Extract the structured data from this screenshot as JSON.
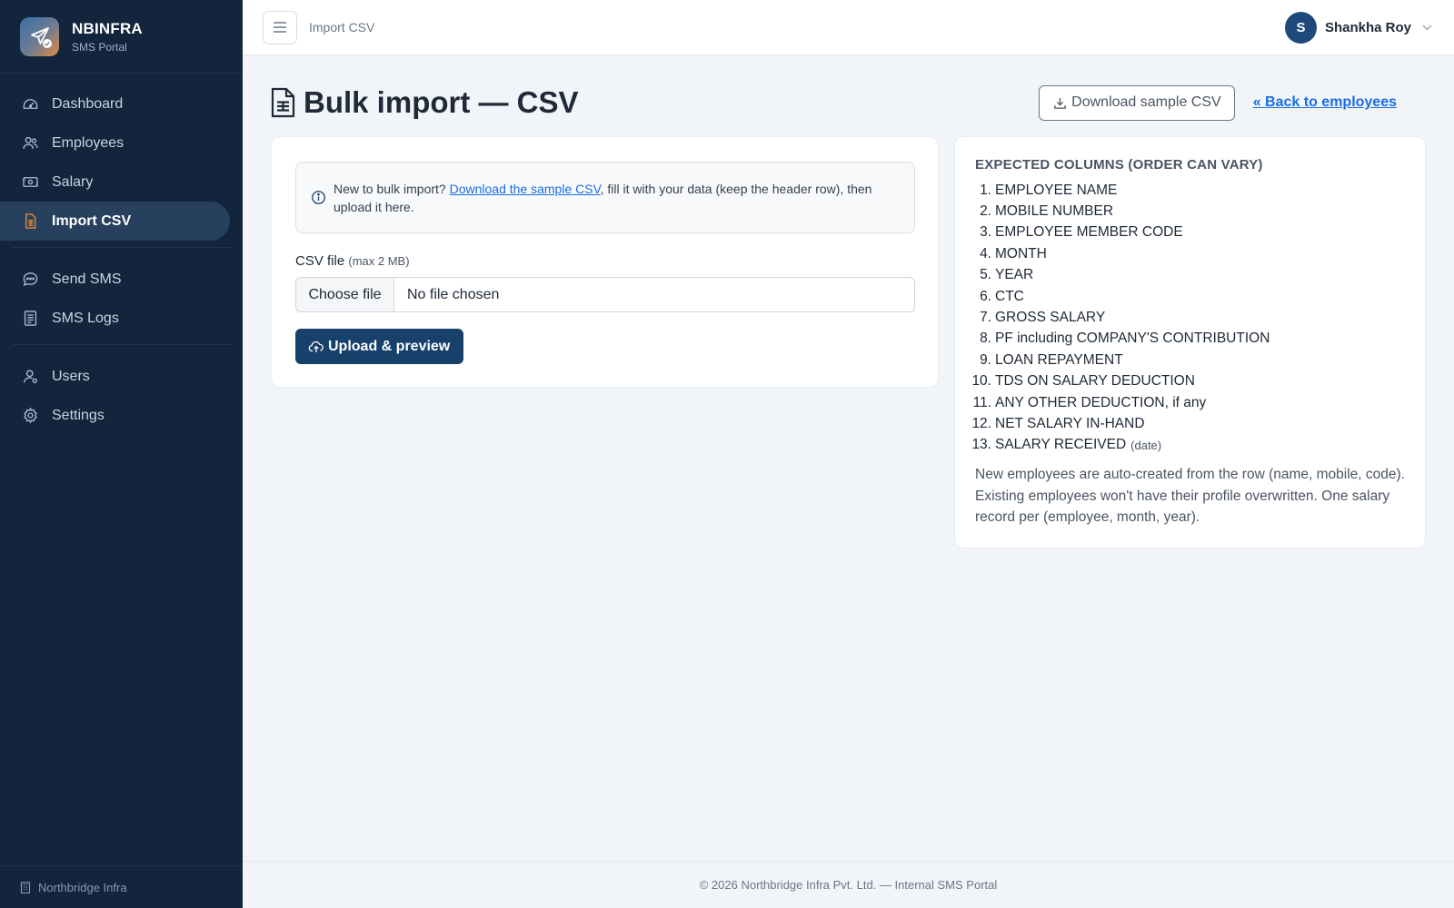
{
  "brand": {
    "name": "NBINFRA",
    "subtitle": "SMS Portal"
  },
  "sidebar": {
    "items": [
      {
        "label": "Dashboard",
        "icon": "gauge-icon",
        "active": false
      },
      {
        "label": "Employees",
        "icon": "users-icon",
        "active": false
      },
      {
        "label": "Salary",
        "icon": "cash-icon",
        "active": false
      },
      {
        "label": "Import CSV",
        "icon": "file-spreadsheet-icon",
        "active": true
      },
      {
        "label": "Send SMS",
        "icon": "chat-icon",
        "active": false
      },
      {
        "label": "SMS Logs",
        "icon": "log-icon",
        "active": false
      },
      {
        "label": "Users",
        "icon": "user-icon",
        "active": false
      },
      {
        "label": "Settings",
        "icon": "gear-icon",
        "active": false
      }
    ],
    "footer": "Northbridge Infra"
  },
  "topbar": {
    "title": "Import CSV",
    "user_initial": "S",
    "user_name": "Shankha Roy"
  },
  "page": {
    "title": "Bulk import — CSV",
    "download_button": "Download sample CSV",
    "back_link": "« Back to employees"
  },
  "upload": {
    "info_prefix": "New to bulk import? ",
    "info_link": "Download the sample CSV",
    "info_suffix": ", fill it with your data (keep the header row), then upload it here.",
    "field_label": "CSV file",
    "field_hint": "(max 2 MB)",
    "choose_file": "Choose file",
    "file_status": "No file chosen",
    "submit": "Upload & preview"
  },
  "columns": {
    "title": "EXPECTED COLUMNS (ORDER CAN VARY)",
    "items": [
      {
        "num": "1.",
        "label": "EMPLOYEE NAME",
        "note": ""
      },
      {
        "num": "2.",
        "label": "MOBILE NUMBER",
        "note": ""
      },
      {
        "num": "3.",
        "label": "EMPLOYEE MEMBER CODE",
        "note": ""
      },
      {
        "num": "4.",
        "label": "MONTH",
        "note": ""
      },
      {
        "num": "5.",
        "label": "YEAR",
        "note": ""
      },
      {
        "num": "6.",
        "label": "CTC",
        "note": ""
      },
      {
        "num": "7.",
        "label": "GROSS SALARY",
        "note": ""
      },
      {
        "num": "8.",
        "label": "PF including COMPANY'S CONTRIBUTION",
        "note": ""
      },
      {
        "num": "9.",
        "label": "LOAN REPAYMENT",
        "note": ""
      },
      {
        "num": "10.",
        "label": "TDS ON SALARY DEDUCTION",
        "note": ""
      },
      {
        "num": "11.",
        "label": "ANY OTHER DEDUCTION, if any",
        "note": ""
      },
      {
        "num": "12.",
        "label": "NET SALARY IN-HAND",
        "note": ""
      },
      {
        "num": "13.",
        "label": "SALARY RECEIVED",
        "note": "(date)"
      }
    ],
    "description": "New employees are auto-created from the row (name, mobile, code). Existing employees won't have their profile overwritten. One salary record per (employee, month, year)."
  },
  "footer": {
    "text": "© 2026 Northbridge Infra Pvt. Ltd. — Internal SMS Portal"
  },
  "colors": {
    "sidebar_bg": "#13253d",
    "primary": "#17406b",
    "link": "#1a6de0",
    "accent_icon": "#e28a3f"
  }
}
